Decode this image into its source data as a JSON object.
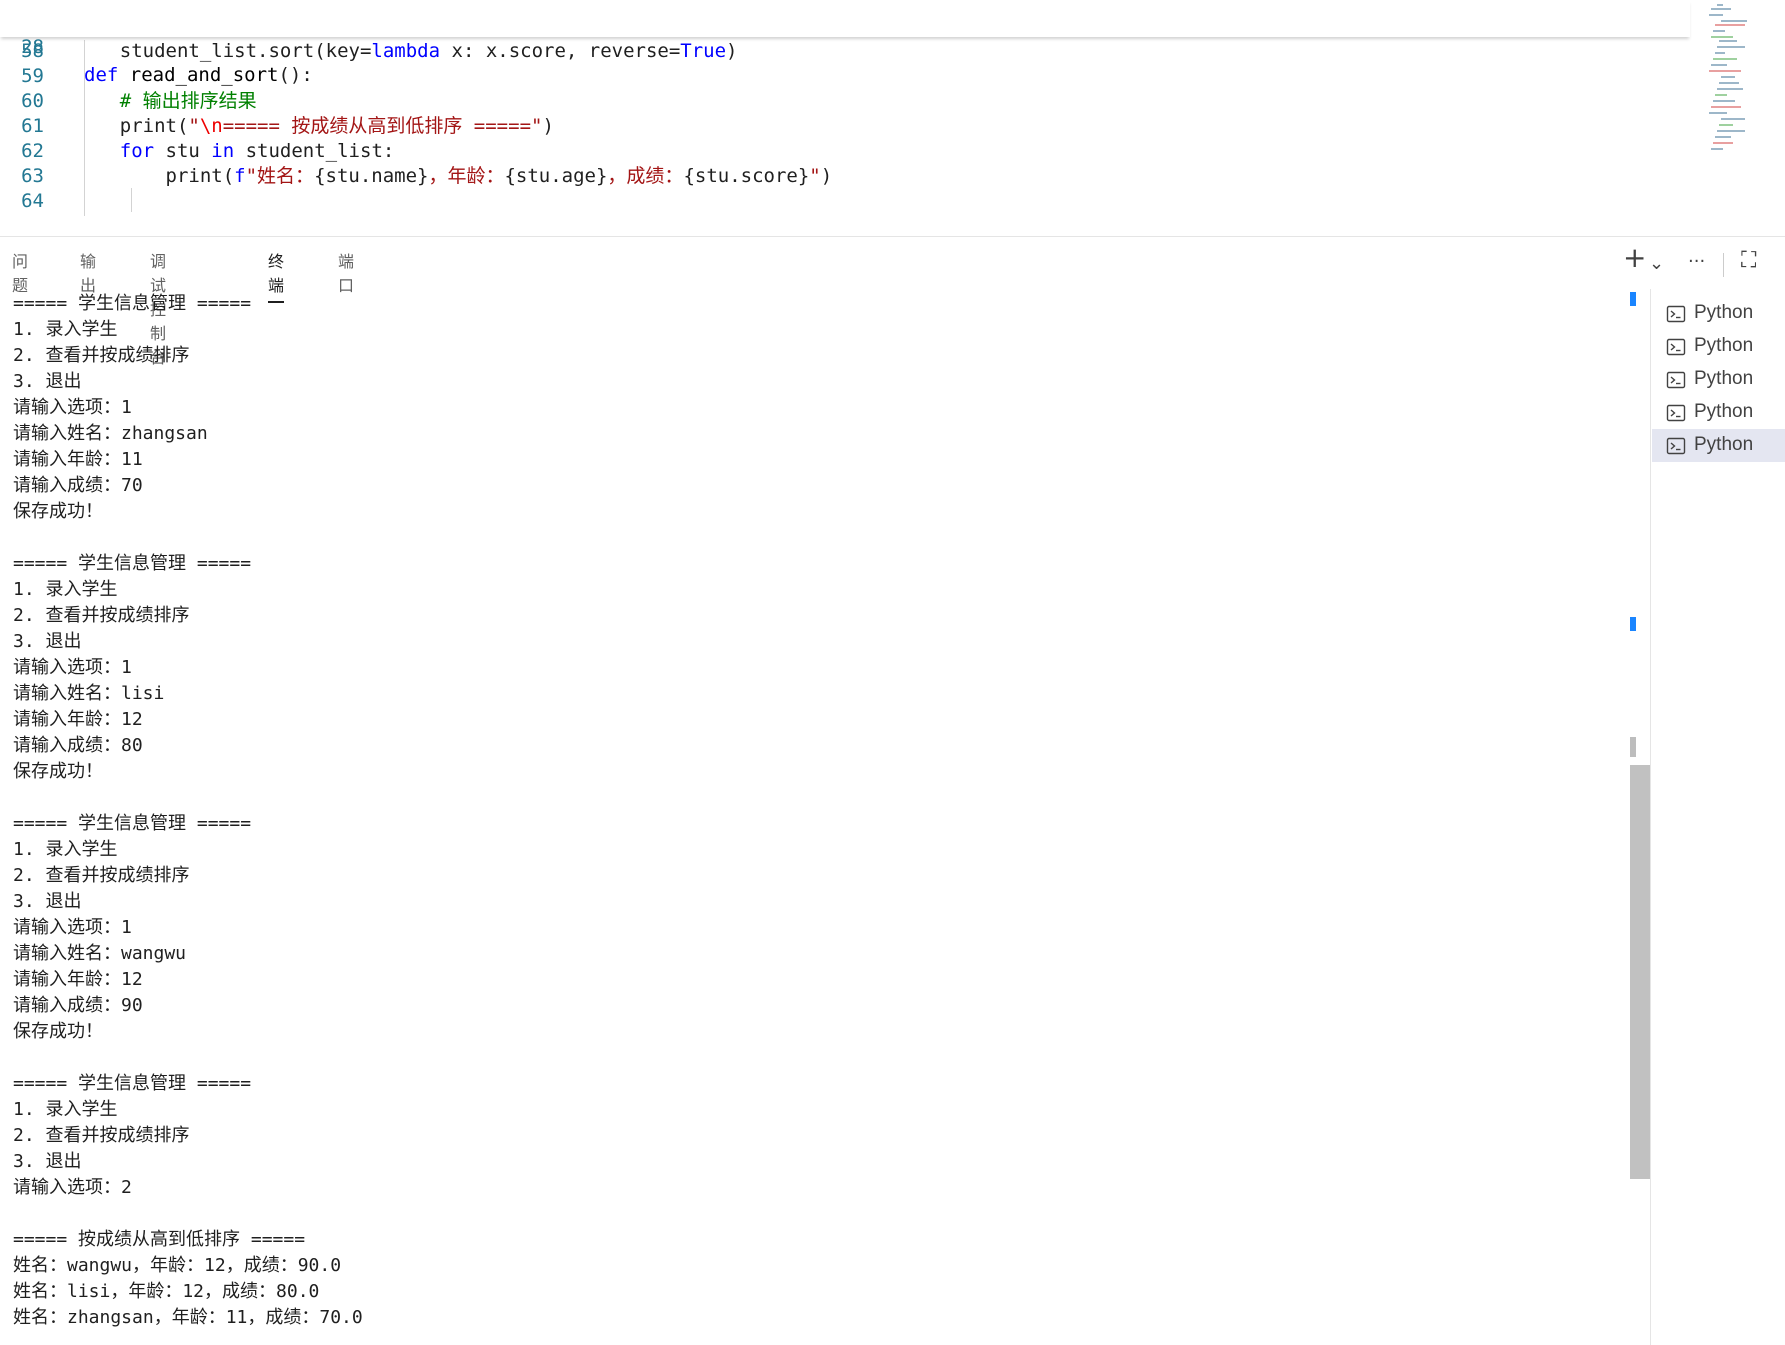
{
  "editor": {
    "sticky": {
      "line_number": "28",
      "code": [
        [
          "kw",
          "def"
        ],
        [
          "fn",
          " read_and_sort"
        ],
        [
          "p",
          "():"
        ]
      ]
    },
    "lines": [
      {
        "n": "58",
        "code": [
          [
            "p",
            "    student_list.sort(key="
          ],
          [
            "kw",
            "lambda"
          ],
          [
            "p",
            " x: x.score, reverse="
          ],
          [
            "kw",
            "True"
          ],
          [
            "p",
            ")"
          ]
        ]
      },
      {
        "n": "59",
        "code": []
      },
      {
        "n": "60",
        "code": [
          [
            "cm",
            "    # 输出排序结果"
          ]
        ]
      },
      {
        "n": "61",
        "code": [
          [
            "p",
            "    print("
          ],
          [
            "str",
            "\""
          ],
          [
            "esc",
            "\\n"
          ],
          [
            "str",
            "===== 按成绩从高到低排序 =====\""
          ],
          [
            "p",
            ")"
          ]
        ]
      },
      {
        "n": "62",
        "code": [
          [
            "kw",
            "    for"
          ],
          [
            "p",
            " stu "
          ],
          [
            "kw",
            "in"
          ],
          [
            "p",
            " student_list:"
          ]
        ]
      },
      {
        "n": "63",
        "code": [
          [
            "p",
            "        print("
          ],
          [
            "kw",
            "f"
          ],
          [
            "str",
            "\"姓名："
          ],
          [
            "p",
            "{stu.name}"
          ],
          [
            "str",
            "，年龄："
          ],
          [
            "p",
            "{stu.age}"
          ],
          [
            "str",
            "，成绩："
          ],
          [
            "p",
            "{stu.score}"
          ],
          [
            "str",
            "\""
          ],
          [
            "p",
            ")"
          ]
        ]
      },
      {
        "n": "64",
        "code": []
      }
    ]
  },
  "panel": {
    "tabs": [
      "问题",
      "输出",
      "调试控制台",
      "终端",
      "端口"
    ],
    "active_tab": "终端",
    "actions": {
      "new_terminal": "+",
      "dropdown": "⌄",
      "more": "···",
      "maximize": "⛶"
    }
  },
  "terminal": {
    "lines": [
      "===== 学生信息管理 =====",
      "1. 录入学生",
      "2. 查看并按成绩排序",
      "3. 退出",
      "请输入选项：1",
      "请输入姓名：zhangsan",
      "请输入年龄：11",
      "请输入成绩：70",
      "保存成功！",
      "",
      "===== 学生信息管理 =====",
      "1. 录入学生",
      "2. 查看并按成绩排序",
      "3. 退出",
      "请输入选项：1",
      "请输入姓名：lisi",
      "请输入年龄：12",
      "请输入成绩：80",
      "保存成功！",
      "",
      "===== 学生信息管理 =====",
      "1. 录入学生",
      "2. 查看并按成绩排序",
      "3. 退出",
      "请输入选项：1",
      "请输入姓名：wangwu",
      "请输入年龄：12",
      "请输入成绩：90",
      "保存成功！",
      "",
      "===== 学生信息管理 =====",
      "1. 录入学生",
      "2. 查看并按成绩排序",
      "3. 退出",
      "请输入选项：2",
      "",
      "===== 按成绩从高到低排序 =====",
      "姓名：wangwu，年龄：12，成绩：90.0",
      "姓名：lisi，年龄：12，成绩：80.0",
      "姓名：zhangsan，年龄：11，成绩：70.0"
    ]
  },
  "terminal_list": {
    "items": [
      "Python",
      "Python",
      "Python",
      "Python",
      "Python"
    ],
    "selected_index": 4
  },
  "colors": {
    "keyword": "#0000ff",
    "string": "#a31515",
    "comment": "#008000",
    "line_number": "#237893",
    "accent": "#1a85ff"
  }
}
